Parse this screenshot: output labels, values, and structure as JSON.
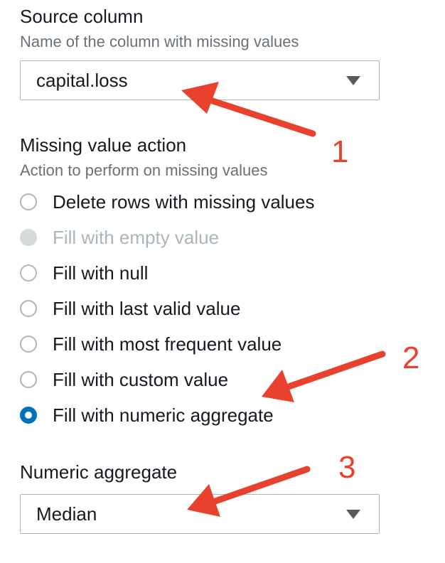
{
  "source_column": {
    "label": "Source column",
    "description": "Name of the column with missing values",
    "value": "capital.loss"
  },
  "missing_value_action": {
    "label": "Missing value action",
    "description": "Action to perform on missing values",
    "options": [
      {
        "label": "Delete rows with missing values",
        "state": "unselected"
      },
      {
        "label": "Fill with empty value",
        "state": "disabled"
      },
      {
        "label": "Fill with null",
        "state": "unselected"
      },
      {
        "label": "Fill with last valid value",
        "state": "unselected"
      },
      {
        "label": "Fill with most frequent value",
        "state": "unselected"
      },
      {
        "label": "Fill with custom value",
        "state": "unselected"
      },
      {
        "label": "Fill with numeric aggregate",
        "state": "selected"
      }
    ]
  },
  "numeric_aggregate": {
    "label": "Numeric aggregate",
    "value": "Median"
  },
  "annotations": [
    "1",
    "2",
    "3"
  ],
  "colors": {
    "annotation": "#e8412e",
    "radio_selected": "#0073bb",
    "border": "#aab7b8",
    "muted_text": "#687078"
  }
}
